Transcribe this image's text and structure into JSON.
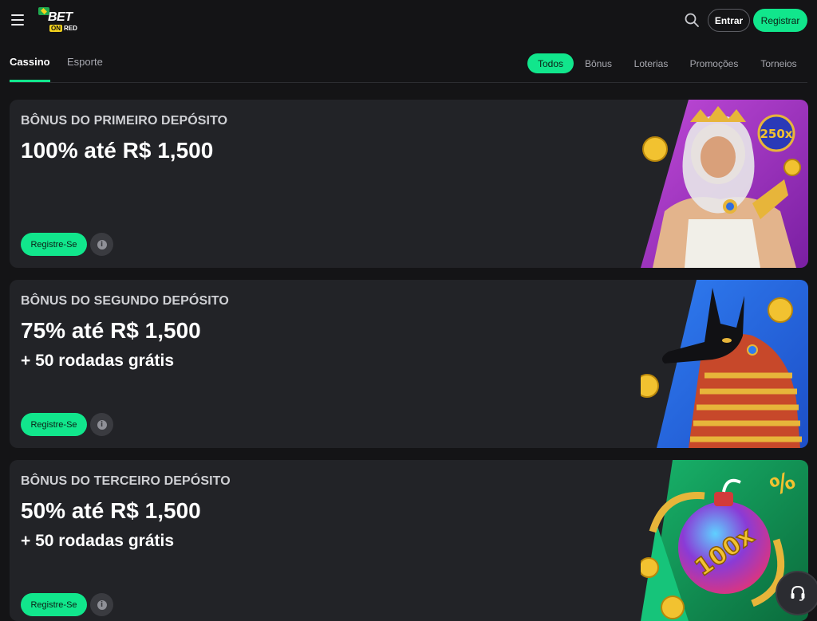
{
  "header": {
    "logo": {
      "bet": "BET",
      "on": "ON",
      "red": "RED"
    },
    "login_label": "Entrar",
    "register_label": "Registrar"
  },
  "tabs": {
    "main": [
      {
        "label": "Cassino",
        "active": true
      },
      {
        "label": "Esporte",
        "active": false
      }
    ],
    "filters": [
      {
        "label": "Todos",
        "active": true
      },
      {
        "label": "Bônus",
        "active": false
      },
      {
        "label": "Loterias",
        "active": false
      },
      {
        "label": "Promoções",
        "active": false
      },
      {
        "label": "Torneios",
        "active": false
      }
    ]
  },
  "promos": [
    {
      "title": "BÔNUS DO PRIMEIRO DEPÓSITO",
      "amount": "100% até R$ 1,500",
      "extra": "",
      "button": "Registre-Se",
      "art": "zeus-illustration",
      "art_badge": "250x"
    },
    {
      "title": "BÔNUS DO SEGUNDO DEPÓSITO",
      "amount": "75% até R$ 1,500",
      "extra": "+ 50 rodadas grátis",
      "button": "Registre-Se",
      "art": "anubis-illustration"
    },
    {
      "title": "BÔNUS DO TERCEIRO DEPÓSITO",
      "amount": "50% até R$ 1,500",
      "extra": "+ 50 rodadas grátis",
      "button": "Registre-Se",
      "art": "candy-bomb-illustration",
      "art_badge": "100x"
    }
  ],
  "colors": {
    "accent": "#11e68c",
    "background": "#141416",
    "card": "#222327"
  }
}
